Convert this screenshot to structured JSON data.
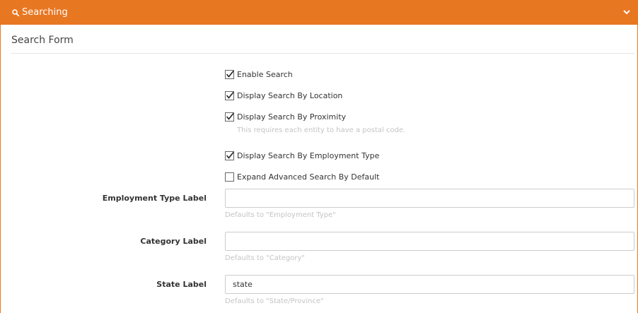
{
  "header": {
    "title": "Searching",
    "icon": "search-icon",
    "collapse_icon": "chevron-down-icon",
    "color": "#e87722"
  },
  "section": {
    "title": "Search Form"
  },
  "checkboxes": [
    {
      "label": "Enable Search",
      "checked": true
    },
    {
      "label": "Display Search By Location",
      "checked": true
    },
    {
      "label": "Display Search By Proximity",
      "checked": true,
      "help": "This requires each entity to have a postal code."
    },
    {
      "label": "Display Search By Employment Type",
      "checked": true
    },
    {
      "label": "Expand Advanced Search By Default",
      "checked": false
    }
  ],
  "fields": [
    {
      "label": "Employment Type Label",
      "value": "",
      "help": "Defaults to \"Employment Type\""
    },
    {
      "label": "Category Label",
      "value": "",
      "help": "Defaults to \"Category\""
    },
    {
      "label": "State Label",
      "value": "state",
      "help": "Defaults to \"State/Province\""
    }
  ]
}
